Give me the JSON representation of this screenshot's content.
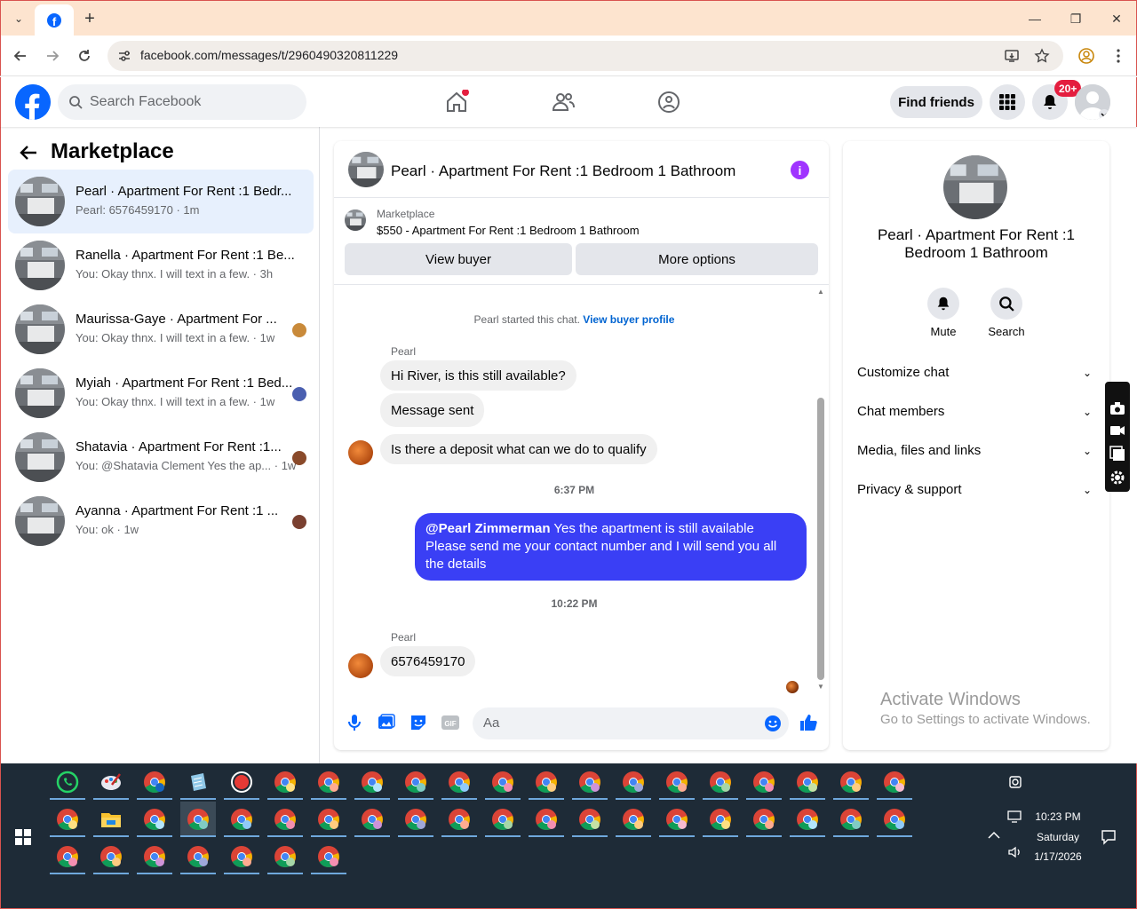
{
  "browser": {
    "url": "facebook.com/messages/t/2960490320811229",
    "new_tab": "+",
    "tab_dropdown": "⌄",
    "minimize": "—",
    "maximize": "❐",
    "close": "✕"
  },
  "header": {
    "search_placeholder": "Search Facebook",
    "find_friends": "Find friends",
    "notif_badge": "20+"
  },
  "sidebar": {
    "title": "Marketplace",
    "conversations": [
      {
        "title": "Pearl · Apartment For Rent :1 Bedr...",
        "subtitle": "Pearl: 6576459170 · 1m"
      },
      {
        "title": "Ranella · Apartment For Rent :1 Be...",
        "subtitle": "You: Okay thnx. I will text in a few. · 3h"
      },
      {
        "title": "Maurissa-Gaye · Apartment For ...",
        "subtitle": "You: Okay thnx. I will text in a few. · 1w"
      },
      {
        "title": "Myiah · Apartment For Rent :1 Bed...",
        "subtitle": "You: Okay thnx. I will text in a few. · 1w"
      },
      {
        "title": "Shatavia · Apartment For Rent :1...",
        "subtitle": "You: @Shatavia Clement Yes the ap... · 1w"
      },
      {
        "title": "Ayanna · Apartment For Rent :1 ...",
        "subtitle": "You: ok · 1w"
      }
    ]
  },
  "chat": {
    "title": "Pearl · Apartment For Rent :1 Bedroom 1 Bathroom",
    "listing_label": "Marketplace",
    "listing_price": "$550 - Apartment For Rent :1 Bedroom 1 Bathroom",
    "view_buyer": "View buyer",
    "more_options": "More options",
    "started_text": "Pearl started this chat.",
    "view_buyer_profile": "View buyer profile",
    "sender_1": "Pearl",
    "msg_1": "Hi River, is this still available?",
    "msg_2": "Message sent",
    "msg_3": "Is there a deposit what can we do to qualify",
    "time_1": "6:37 PM",
    "out_mention": "@Pearl Zimmerman",
    "out_text": " Yes the apartment is still available Please send me your contact number and I will send you all the details",
    "time_2": "10:22 PM",
    "sender_2": "Pearl",
    "msg_4": "6576459170",
    "composer_placeholder": "Aa"
  },
  "details": {
    "title": "Pearl · Apartment For Rent :1 Bedroom 1 Bathroom",
    "mute": "Mute",
    "search": "Search",
    "rows": [
      "Customize chat",
      "Chat members",
      "Media, files and links",
      "Privacy & support"
    ]
  },
  "watermark": {
    "line1": "Activate Windows",
    "line2": "Go to Settings to activate Windows."
  },
  "tray": {
    "time": "10:23 PM",
    "day": "Saturday",
    "date": "1/17/2026"
  },
  "colors": {
    "fb_blue": "#0866ff",
    "outgoing_bubble": "#3a3ff5",
    "link": "#0064d1",
    "notif_red": "#e41e3f",
    "taskbar": "#1e2b37"
  }
}
